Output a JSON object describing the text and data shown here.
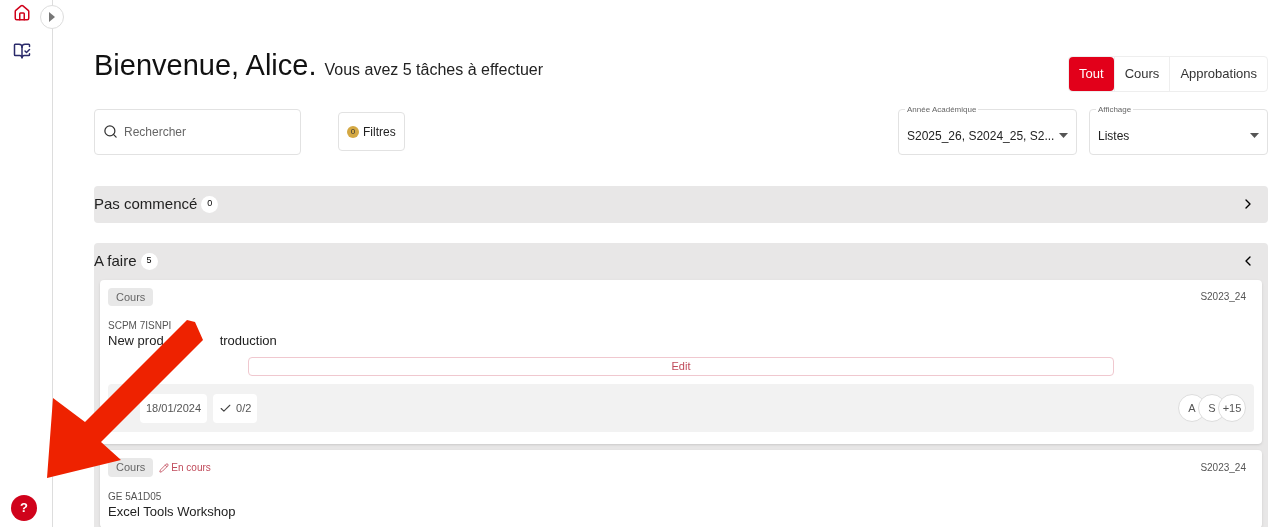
{
  "greeting": "Bienvenue, Alice.",
  "subtitle": "Vous avez 5 tâches à effectuer",
  "tabs": [
    {
      "label": "Tout",
      "selected": true
    },
    {
      "label": "Cours",
      "selected": false
    },
    {
      "label": "Approbations",
      "selected": false
    }
  ],
  "search": {
    "placeholder": "Rechercher"
  },
  "filters": {
    "label": "Filtres",
    "count": "0"
  },
  "academic_year": {
    "label": "Année Académique",
    "value": "S2025_26, S2024_25, S2..."
  },
  "display": {
    "label": "Affichage",
    "value": "Listes"
  },
  "help": "?",
  "sections": [
    {
      "title": "Pas commencé",
      "count": "0",
      "expanded": false
    },
    {
      "title": "A faire",
      "count": "5",
      "expanded": true,
      "tasks": [
        {
          "tag": "Cours",
          "year": "S2023_24",
          "code": "SCPM 7ISNPI",
          "title_parts": [
            "New prod",
            "troduction"
          ],
          "edit": "Edit",
          "date": "18/01/2024",
          "progress": "0/2",
          "avatars": [
            "A",
            "S",
            "+15"
          ]
        },
        {
          "tag": "Cours",
          "status": "En cours",
          "year": "S2023_24",
          "code": "GE 5A1D05",
          "title": "Excel Tools Workshop"
        }
      ]
    }
  ]
}
